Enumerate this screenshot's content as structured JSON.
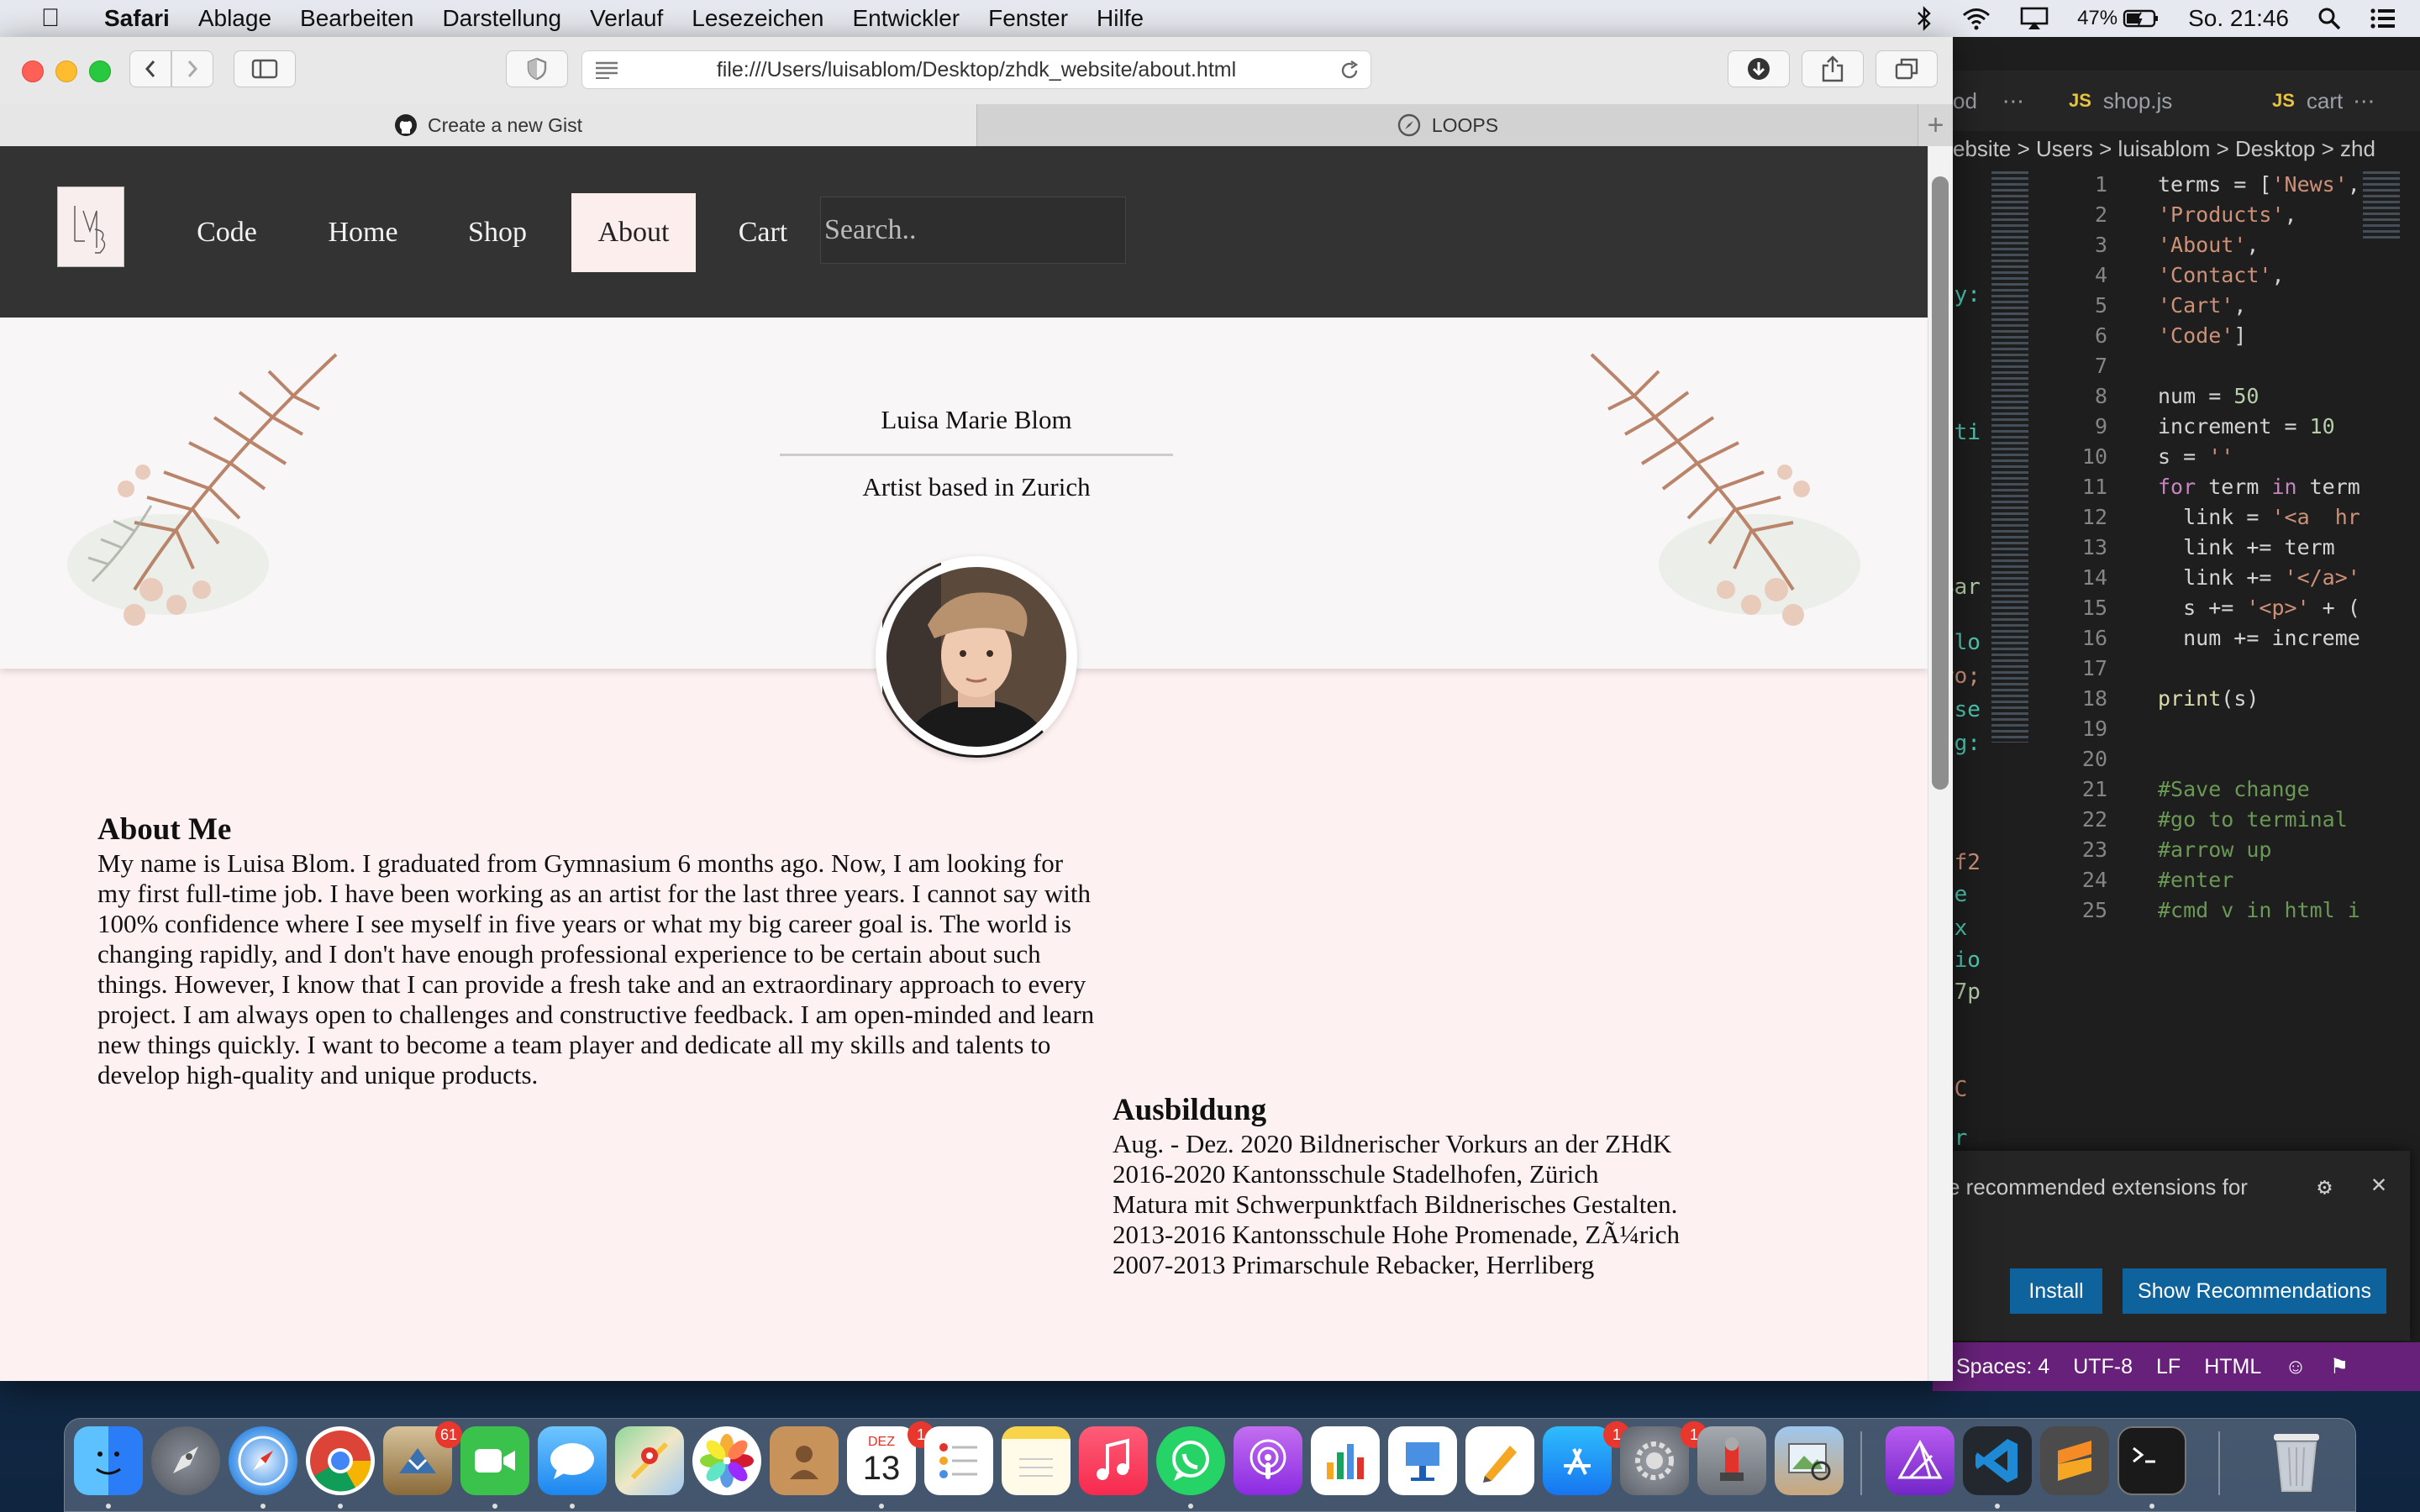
{
  "menubar": {
    "app": "Safari",
    "items": [
      "Ablage",
      "Bearbeiten",
      "Darstellung",
      "Verlauf",
      "Lesezeichen",
      "Entwickler",
      "Fenster",
      "Hilfe"
    ],
    "battery": "47%",
    "clock": "So. 21:46"
  },
  "safari": {
    "url": "file:///Users/luisablom/Desktop/zhdk_website/about.html",
    "tabs": [
      {
        "label": "Create a new Gist",
        "active": false
      },
      {
        "label": "LOOPS",
        "active": true
      }
    ]
  },
  "site": {
    "nav": [
      "Code",
      "Home",
      "Shop",
      "About",
      "Cart"
    ],
    "active_nav": "About",
    "search_placeholder": "Search..",
    "hero_name": "Luisa Marie Blom",
    "hero_subtitle": "Artist based in Zurich",
    "about_heading": "About Me",
    "about_text": "My name is Luisa Blom. I graduated from Gymnasium 6 months ago. Now, I am looking for my first full-time job. I have been working as an artist for the last three years. I cannot say with 100% confidence where I see myself in five years or what my big career goal is. The world is changing rapidly, and I don't have enough professional experience to be certain about such things. However, I know that I can provide a fresh take and an extraordinary approach to every project. I am always open to challenges and constructive feedback. I am open-minded and learn new things quickly. I want to become a team player and dedicate all my skills and talents to develop high-quality and unique products.",
    "education_heading": "Ausbildung",
    "education": [
      "Aug. - Dez. 2020 Bildnerischer Vorkurs an der ZHdK",
      "2016-2020 Kantonsschule Stadelhofen, Zürich",
      "Matura mit Schwerpunktfach Bildnerisches Gestalten.",
      "2013-2016 Kantonsschule Hohe Promenade, ZÃ¼rich",
      "2007-2013 Primarschule Rebacker, Herrliberg"
    ]
  },
  "vscode": {
    "tabs": [
      "shop.js",
      "cart"
    ],
    "breadcrumb": "ebsite > Users > luisablom > Desktop > zhd",
    "line_numbers": [
      "1",
      "2",
      "3",
      "4",
      "5",
      "6",
      "7",
      "8",
      "9",
      "10",
      "11",
      "12",
      "13",
      "14",
      "15",
      "16",
      "17",
      "18",
      "19",
      "20",
      "21",
      "22",
      "23",
      "24",
      "25"
    ],
    "notification": "e recommended extensions for",
    "install_label": "Install",
    "show_label": "Show Recommendations",
    "status": [
      "Spaces: 4",
      "UTF-8",
      "LF",
      "HTML"
    ]
  },
  "dock": {
    "mail_badge": "61",
    "calendar_month": "DEZ",
    "calendar_day": "13",
    "calendar_badge": "1",
    "appstore_badge": "1",
    "settings_badge": "1"
  },
  "colors": {
    "nav_bg": "#333333",
    "page_bg": "#fdf1f1",
    "active_nav_bg": "#fdeeee",
    "vscode_status": "#68217a",
    "vscode_button": "#0e639c"
  }
}
